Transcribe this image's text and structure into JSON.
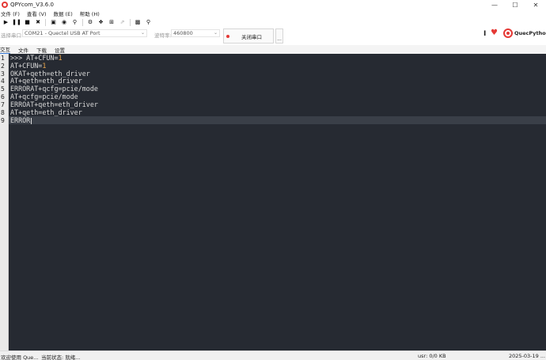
{
  "window": {
    "title": "QPYcom_V3.6.0",
    "minimize": "—",
    "maximize": "☐",
    "close": "✕"
  },
  "menu": {
    "items": [
      "文件 (F)",
      "查看 (V)",
      "数据 (E)",
      "帮助 (H)"
    ]
  },
  "toolbar": {
    "icons": [
      "play-icon",
      "pause-icon",
      "stop-icon",
      "close-icon",
      "screenshot-icon",
      "record-icon",
      "search-icon",
      "settings-icon",
      "package-icon",
      "add-icon",
      "external-icon",
      "save-icon",
      "find-icon"
    ]
  },
  "port": {
    "label": "选择串口:",
    "selected": "COM21 - Quectel USB AT Port",
    "baud_label": "波特率:",
    "baud_value": "460800",
    "close_label": "关闭串口",
    "more_label": "...",
    "brand": "QuecPython"
  },
  "tabs": [
    "交互",
    "文件",
    "下载",
    "设置"
  ],
  "terminal": {
    "line_numbers": [
      "1",
      "2",
      "3",
      "4",
      "5",
      "6",
      "7",
      "8",
      "9"
    ],
    "lines": [
      {
        "text": ">>> AT+CFUN=",
        "num": "1"
      },
      {
        "text": "AT+CFUN=",
        "num": "1"
      },
      {
        "text": "OKAT+qeth=eth_driver",
        "num": ""
      },
      {
        "text": "AT+qeth=eth_driver",
        "num": ""
      },
      {
        "text": "ERRORAT+qcfg=pcie/mode",
        "num": ""
      },
      {
        "text": "AT+qcfg=pcie/mode",
        "num": ""
      },
      {
        "text": "ERROAT+qeth=eth_driver",
        "num": ""
      },
      {
        "text": "AT+qeth=eth_driver",
        "num": ""
      },
      {
        "text": "ERROR",
        "num": ""
      }
    ]
  },
  "status": {
    "welcome": "欢迎使用 Que...",
    "state": "当前状态: 就绪...",
    "usr": "usr: 0/0 KB",
    "date": "2025-03-19 ..."
  },
  "colors": {
    "accent": "#e53935",
    "editor_bg": "#262a32",
    "number": "#e8a54b"
  }
}
